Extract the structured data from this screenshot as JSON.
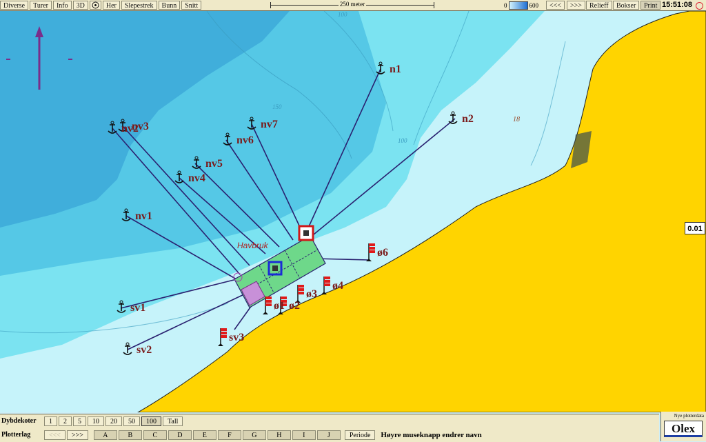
{
  "menu": [
    "Diverse",
    "Turer",
    "Info",
    "3D",
    "Her",
    "Slepestrek",
    "Bunn",
    "Snitt"
  ],
  "scale_label": "250 meter",
  "depth_min": "0",
  "depth_max": "600",
  "nav": [
    "<<<",
    ">>>"
  ],
  "right_menu": [
    "Relieff",
    "Bokser",
    "Print"
  ],
  "clock": "15:51:08",
  "badge_value": "0.01",
  "facility_label": "Havbruk",
  "depth_labels": [
    "150",
    "100",
    "18",
    "100"
  ],
  "anchors": [
    "n1",
    "n2",
    "nv7",
    "nv6",
    "nv5",
    "nv4",
    "nv3",
    "nv2",
    "nv1",
    "sv1",
    "sv2"
  ],
  "flags": [
    "ø6",
    "ø4",
    "ø3",
    "ø2",
    "ø1",
    "sv3"
  ],
  "dybdekoter": {
    "label": "Dybdekoter",
    "options": [
      "1",
      "2",
      "5",
      "10",
      "20",
      "50",
      "100",
      "Tall"
    ],
    "selected": "100"
  },
  "plotterlag": {
    "label": "Plotterlag",
    "nav": [
      "<<<",
      ">>>"
    ],
    "layers": [
      "A",
      "B",
      "C",
      "D",
      "E",
      "F",
      "G",
      "H",
      "I",
      "J"
    ],
    "periode": "Periode",
    "hint": "Høyre museknapp endrer navn"
  },
  "brand": {
    "small": "Nye plotterdata",
    "logo": "Olex"
  },
  "colors": {
    "land": "#ffd400",
    "shallow": "#c6f3fa",
    "mid": "#7be3f1",
    "deep": "#55c8e6",
    "deepest": "#40aedb",
    "mooring": "#2a2170",
    "label": "#7a1a1a",
    "cage_fill": "#6ed88a"
  }
}
